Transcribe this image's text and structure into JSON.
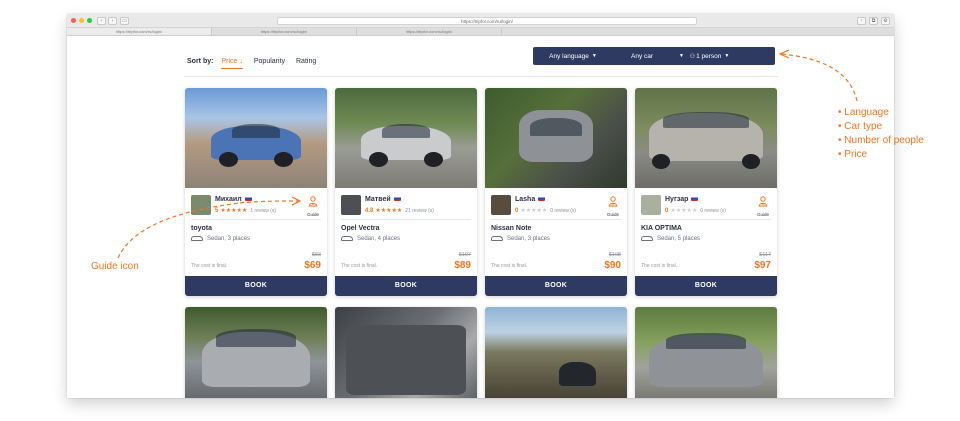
{
  "browser": {
    "address": "https://tripfor.com/ru/login/",
    "tabs": [
      "https://tripfor.com/ru/login/",
      "https://tripfor.com/ru/login/",
      "https://tripfor.com/ru/login/"
    ]
  },
  "sort": {
    "label": "Sort by:",
    "options": [
      {
        "label": "Price",
        "arrow": "↓",
        "active": true
      },
      {
        "label": "Popularity",
        "active": false
      },
      {
        "label": "Rating",
        "active": false
      }
    ]
  },
  "filters": {
    "language": "Any language",
    "car": "Any car",
    "people": "1 person",
    "price": "price"
  },
  "cards": [
    {
      "driver": "Михаил",
      "rating": "5",
      "stars_filled": 5,
      "reviews": "1 review (s)",
      "guide_label": "Guide",
      "model": "toyota",
      "type": "Sedan, 3 places",
      "cost_note": "The cost is final.",
      "old_price": "$83",
      "price": "$69",
      "book": "BOOK"
    },
    {
      "driver": "Матвей",
      "rating": "4.8",
      "stars_filled": 5,
      "reviews": "21 review (s)",
      "guide_label": "",
      "model": "Opel Vectra",
      "type": "Sedan, 4 places",
      "cost_note": "The cost is final.",
      "old_price": "$107",
      "price": "$89",
      "book": "BOOK"
    },
    {
      "driver": "Lasha",
      "rating": "0",
      "stars_filled": 0,
      "reviews": "0 review (s)",
      "guide_label": "Guide",
      "model": "Nissan Note",
      "type": "Sedan, 3 places",
      "cost_note": "The cost is final.",
      "old_price": "$108",
      "price": "$90",
      "book": "BOOK"
    },
    {
      "driver": "Нугзар",
      "rating": "0",
      "stars_filled": 0,
      "reviews": "0 review (s)",
      "guide_label": "Guide",
      "model": "KIA OPTIMA",
      "type": "Sedan, 5 places",
      "cost_note": "The cost is final.",
      "old_price": "$117",
      "price": "$97",
      "book": "BOOK"
    }
  ],
  "annotations": {
    "guide_icon": "Guide icon",
    "filters_list": [
      "Language",
      "Car type",
      "Number of people",
      "Price"
    ]
  },
  "colors": {
    "accent": "#f07423",
    "navy": "#2e3a61"
  }
}
